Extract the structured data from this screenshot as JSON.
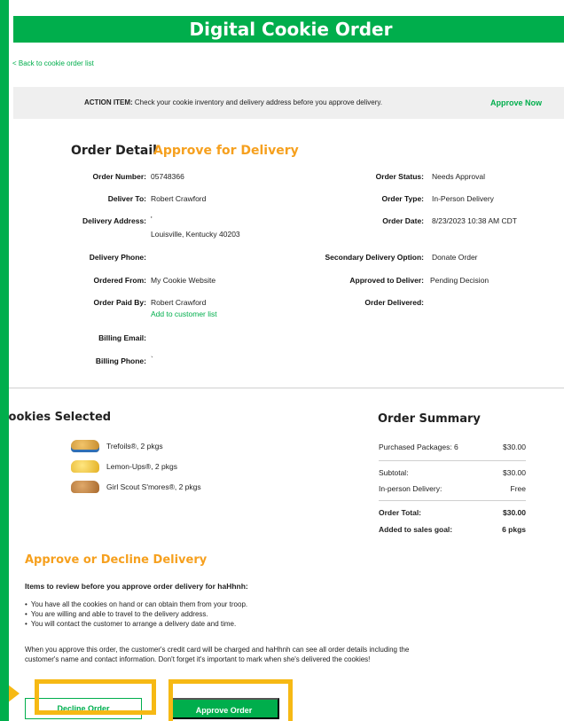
{
  "header": {
    "title": "Digital Cookie Order"
  },
  "nav": {
    "back_link": "< Back to cookie order list"
  },
  "action_bar": {
    "prefix": "ACTION ITEM:",
    "message": " Check your cookie inventory and delivery address before you approve delivery.",
    "approve_now": "Approve Now"
  },
  "order_detail": {
    "title": "Order Detail",
    "subtitle": "Approve for Delivery",
    "left": {
      "order_number_label": "Order Number:",
      "order_number": "05748366",
      "deliver_to_label": "Deliver To:",
      "deliver_to": "Robert Crawford",
      "delivery_address_label": "Delivery Address:",
      "delivery_address_line1": "'",
      "delivery_address_line2": "Louisville, Kentucky 40203",
      "delivery_phone_label": "Delivery Phone:",
      "delivery_phone": "",
      "ordered_from_label": "Ordered From:",
      "ordered_from": "My Cookie Website",
      "order_paid_by_label": "Order Paid By:",
      "order_paid_by": "Robert Crawford",
      "add_to_customer_list": "Add to customer list",
      "billing_email_label": "Billing Email:",
      "billing_email": "",
      "billing_phone_label": "Billing Phone:",
      "billing_phone": "`"
    },
    "right": {
      "order_status_label": "Order Status:",
      "order_status": "Needs Approval",
      "order_type_label": "Order Type:",
      "order_type": "In-Person Delivery",
      "order_date_label": "Order Date:",
      "order_date": "8/23/2023 10:38 AM CDT",
      "secondary_delivery_label": "Secondary Delivery Option:",
      "secondary_delivery": "Donate Order",
      "approved_to_deliver_label": "Approved to Deliver:",
      "approved_to_deliver": "Pending Decision",
      "order_delivered_label": "Order Delivered:",
      "order_delivered": ""
    }
  },
  "cookies": {
    "title": "Cookies Selected",
    "items": [
      {
        "label": "Trefoils®, 2 pkgs",
        "icon": "trefoils-cookie-image"
      },
      {
        "label": "Lemon-Ups®, 2 pkgs",
        "icon": "lemon-ups-cookie-image"
      },
      {
        "label": "Girl Scout S'mores®, 2 pkgs",
        "icon": "smores-cookie-image"
      }
    ]
  },
  "summary": {
    "title": "Order Summary",
    "purchased_label": "Purchased Packages: 6",
    "purchased_value": "$30.00",
    "subtotal_label": "Subtotal:",
    "subtotal_value": "$30.00",
    "delivery_label": "In-person Delivery:",
    "delivery_value": "Free",
    "total_label": "Order Total:",
    "total_value": "$30.00",
    "goal_label": "Added to sales goal:",
    "goal_value": "6 pkgs"
  },
  "approve_section": {
    "title": "Approve or Decline Delivery",
    "items_heading": "Items to review before you approve order delivery for haHhnh:",
    "items": [
      "You have all the cookies on hand or can obtain them from your troop.",
      "You are willing and able to travel to the delivery address.",
      "You will contact the customer to arrange a delivery date and time."
    ],
    "paragraph": "When you approve this order, the customer's credit card will be charged and haHhnh can see all order details including the customer's name and contact information. Don't forget it's important to mark when she's delivered the cookies!",
    "decline_button": "Decline Order",
    "approve_button": "Approve Order"
  },
  "colors": {
    "brand_green": "#00ae4c",
    "accent_orange": "#f6a01e",
    "highlight_yellow": "#f6b914"
  }
}
